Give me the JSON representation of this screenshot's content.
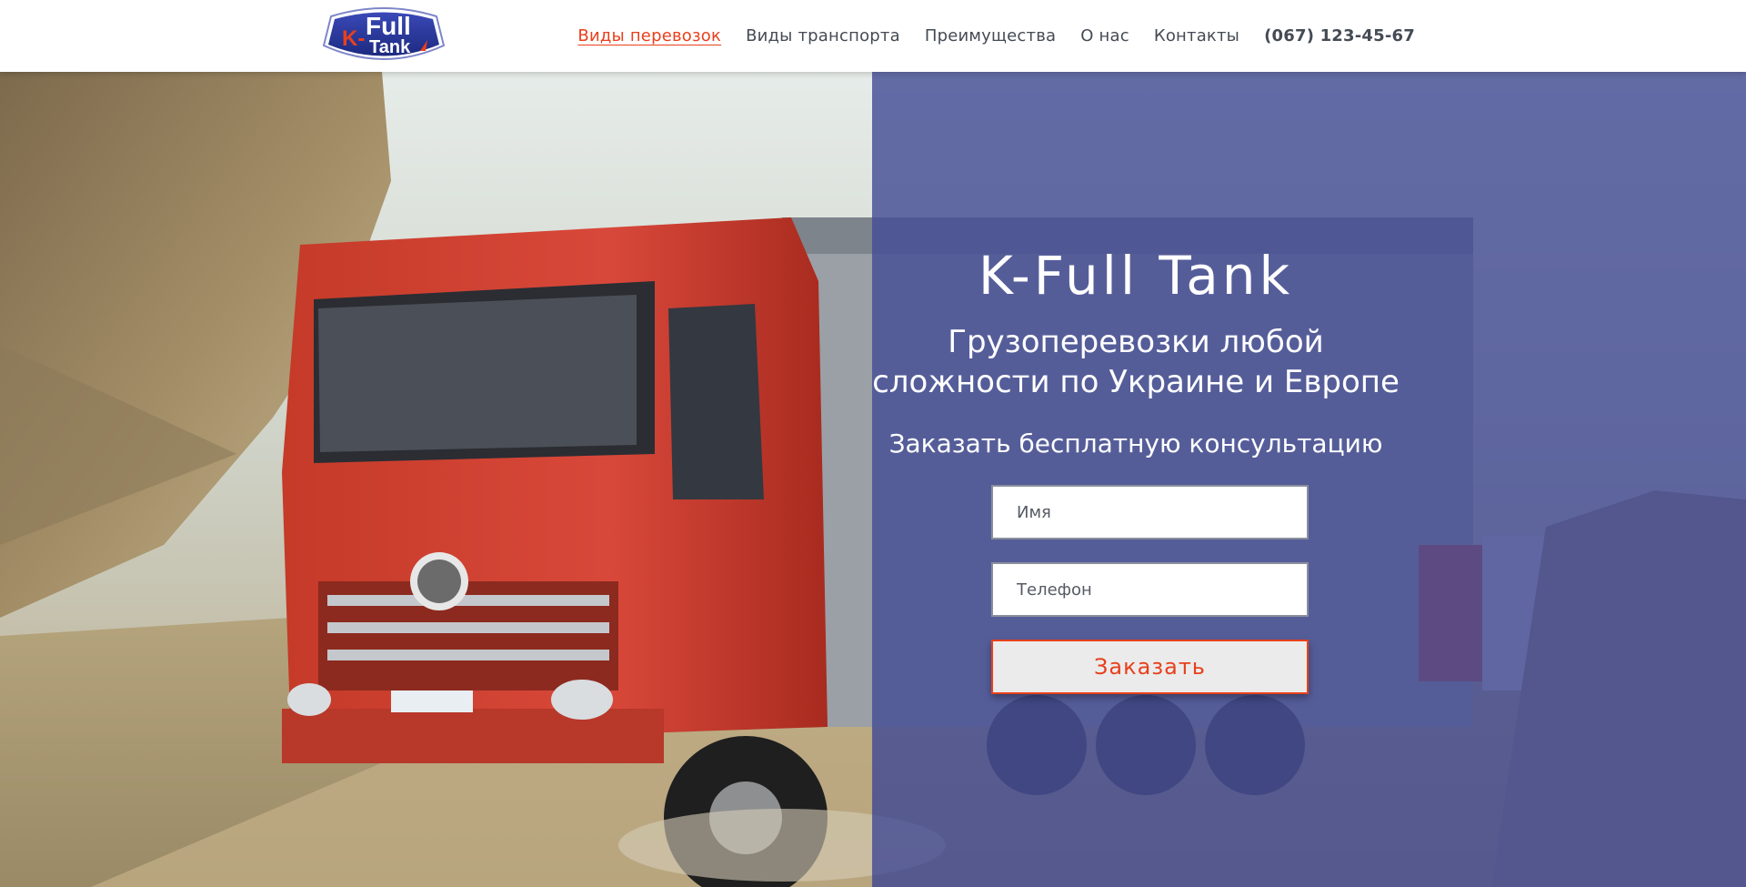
{
  "header": {
    "logo": {
      "line1": "Full",
      "line2": "Tank",
      "prefix": "K-"
    },
    "nav": [
      {
        "label": "Виды перевозок",
        "active": true
      },
      {
        "label": "Виды транспорта"
      },
      {
        "label": "Преимущества"
      },
      {
        "label": "О нас"
      },
      {
        "label": "Контакты"
      }
    ],
    "phone": "(067) 123-45-67"
  },
  "hero": {
    "title": "K-Full Tank",
    "subtitle_line1": "Грузоперевозки любой",
    "subtitle_line2": "сложности по Украине и Европе",
    "cta": "Заказать бесплатную консультацию",
    "form": {
      "name_placeholder": "Имя",
      "phone_placeholder": "Телефон",
      "submit_label": "Заказать"
    }
  },
  "colors": {
    "accent": "#e8401c",
    "overlay": "#464e96",
    "nav_text": "#444b55"
  }
}
